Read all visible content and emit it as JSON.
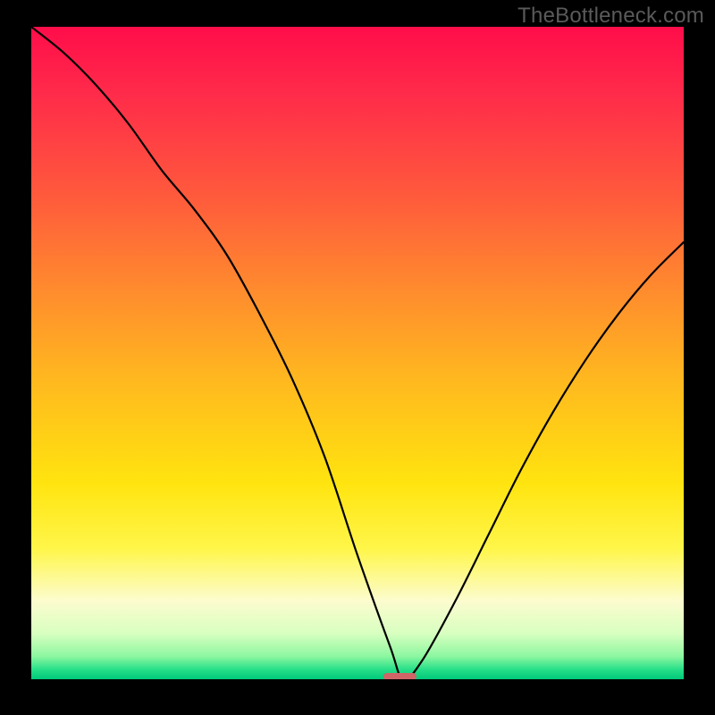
{
  "branding": {
    "watermark": "TheBottleneck.com"
  },
  "chart_data": {
    "type": "line",
    "title": "",
    "xlabel": "",
    "ylabel": "",
    "ylim": [
      0,
      100
    ],
    "x": [
      0,
      5,
      10,
      15,
      20,
      25,
      30,
      35,
      40,
      45,
      50,
      55,
      57,
      60,
      65,
      70,
      75,
      80,
      85,
      90,
      95,
      100
    ],
    "series": [
      {
        "name": "curve",
        "values": [
          100,
          96,
          91,
          85,
          78,
          72,
          65,
          56,
          46,
          34,
          19,
          5,
          0,
          3,
          12,
          22,
          32,
          41,
          49,
          56,
          62,
          67
        ]
      }
    ],
    "marker": {
      "x_center_pct": 56.5,
      "width_pct": 5.0,
      "height_pct": 1.2,
      "color": "#cf6567"
    },
    "background_gradient": {
      "stops": [
        {
          "pos": 0,
          "color": "#ff0d4a"
        },
        {
          "pos": 0.1,
          "color": "#ff2a4a"
        },
        {
          "pos": 0.26,
          "color": "#ff5a3c"
        },
        {
          "pos": 0.4,
          "color": "#ff8a2e"
        },
        {
          "pos": 0.54,
          "color": "#ffb81f"
        },
        {
          "pos": 0.7,
          "color": "#ffe40f"
        },
        {
          "pos": 0.8,
          "color": "#fff64a"
        },
        {
          "pos": 0.88,
          "color": "#fcfccf"
        },
        {
          "pos": 0.93,
          "color": "#d8ffc0"
        },
        {
          "pos": 0.965,
          "color": "#8cf7a0"
        },
        {
          "pos": 0.985,
          "color": "#26df88"
        },
        {
          "pos": 1.0,
          "color": "#00c97a"
        }
      ]
    }
  }
}
